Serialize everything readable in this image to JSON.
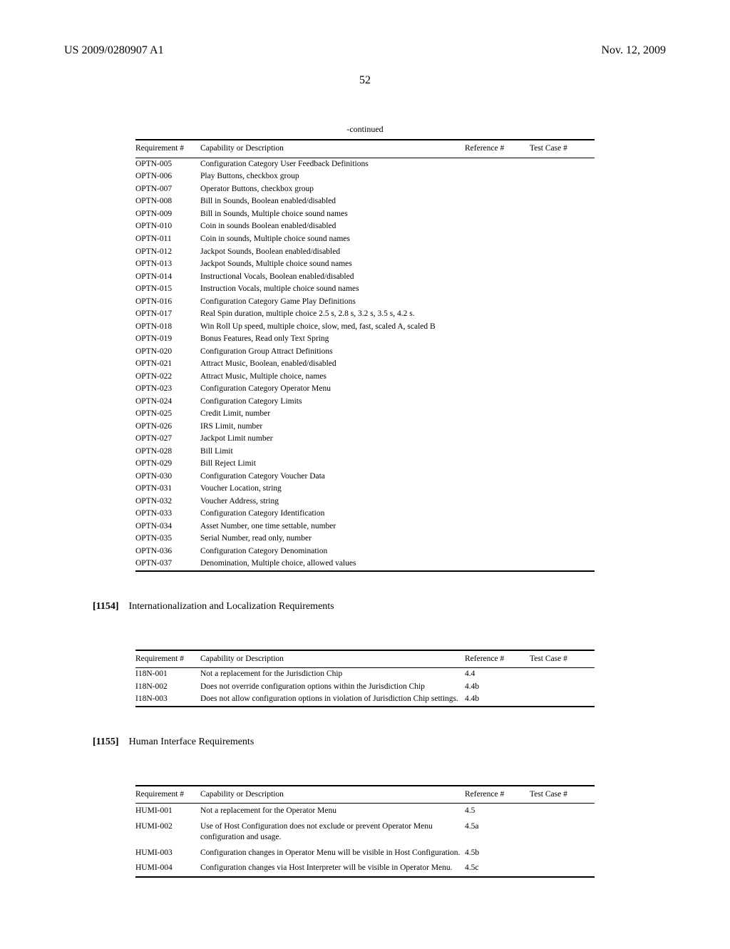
{
  "header": {
    "left": "US 2009/0280907 A1",
    "right": "Nov. 12, 2009"
  },
  "page_number": "52",
  "table1": {
    "caption": "-continued",
    "headers": {
      "req": "Requirement #",
      "desc": "Capability or Description",
      "ref": "Reference #",
      "tc": "Test Case #"
    },
    "rows": [
      {
        "req": "OPTN-005",
        "desc": "Configuration Category User Feedback Definitions",
        "ref": "",
        "tc": ""
      },
      {
        "req": "OPTN-006",
        "desc": "Play Buttons, checkbox group",
        "ref": "",
        "tc": ""
      },
      {
        "req": "OPTN-007",
        "desc": "Operator Buttons, checkbox group",
        "ref": "",
        "tc": ""
      },
      {
        "req": "OPTN-008",
        "desc": "Bill in Sounds, Boolean enabled/disabled",
        "ref": "",
        "tc": ""
      },
      {
        "req": "OPTN-009",
        "desc": "Bill in Sounds, Multiple choice sound names",
        "ref": "",
        "tc": ""
      },
      {
        "req": "OPTN-010",
        "desc": "Coin in sounds Boolean enabled/disabled",
        "ref": "",
        "tc": ""
      },
      {
        "req": "OPTN-011",
        "desc": "Coin in sounds, Multiple choice sound names",
        "ref": "",
        "tc": ""
      },
      {
        "req": "OPTN-012",
        "desc": "Jackpot Sounds, Boolean enabled/disabled",
        "ref": "",
        "tc": ""
      },
      {
        "req": "OPTN-013",
        "desc": "Jackpot Sounds, Multiple choice sound names",
        "ref": "",
        "tc": ""
      },
      {
        "req": "OPTN-014",
        "desc": "Instructional Vocals, Boolean enabled/disabled",
        "ref": "",
        "tc": ""
      },
      {
        "req": "OPTN-015",
        "desc": "Instruction Vocals, multiple choice sound names",
        "ref": "",
        "tc": ""
      },
      {
        "req": "OPTN-016",
        "desc": "Configuration Category Game Play Definitions",
        "ref": "",
        "tc": ""
      },
      {
        "req": "OPTN-017",
        "desc": "Real Spin duration, multiple choice 2.5 s, 2.8 s, 3.2 s, 3.5 s, 4.2 s.",
        "ref": "",
        "tc": ""
      },
      {
        "req": "OPTN-018",
        "desc": "Win Roll Up speed, multiple choice, slow, med, fast, scaled A, scaled B",
        "ref": "",
        "tc": ""
      },
      {
        "req": "OPTN-019",
        "desc": "Bonus Features, Read only Text Spring",
        "ref": "",
        "tc": ""
      },
      {
        "req": "OPTN-020",
        "desc": "Configuration Group Attract Definitions",
        "ref": "",
        "tc": ""
      },
      {
        "req": "OPTN-021",
        "desc": "Attract Music, Boolean, enabled/disabled",
        "ref": "",
        "tc": ""
      },
      {
        "req": "OPTN-022",
        "desc": "Attract Music, Multiple choice, names",
        "ref": "",
        "tc": ""
      },
      {
        "req": "OPTN-023",
        "desc": "Configuration Category Operator Menu",
        "ref": "",
        "tc": ""
      },
      {
        "req": "OPTN-024",
        "desc": "Configuration Category Limits",
        "ref": "",
        "tc": ""
      },
      {
        "req": "OPTN-025",
        "desc": "Credit Limit, number",
        "ref": "",
        "tc": ""
      },
      {
        "req": "OPTN-026",
        "desc": "IRS Limit, number",
        "ref": "",
        "tc": ""
      },
      {
        "req": "OPTN-027",
        "desc": "Jackpot Limit number",
        "ref": "",
        "tc": ""
      },
      {
        "req": "OPTN-028",
        "desc": "Bill Limit",
        "ref": "",
        "tc": ""
      },
      {
        "req": "OPTN-029",
        "desc": "Bill Reject Limit",
        "ref": "",
        "tc": ""
      },
      {
        "req": "OPTN-030",
        "desc": "Configuration Category Voucher Data",
        "ref": "",
        "tc": ""
      },
      {
        "req": "OPTN-031",
        "desc": "Voucher Location, string",
        "ref": "",
        "tc": ""
      },
      {
        "req": "OPTN-032",
        "desc": "Voucher Address, string",
        "ref": "",
        "tc": ""
      },
      {
        "req": "OPTN-033",
        "desc": "Configuration Category Identification",
        "ref": "",
        "tc": ""
      },
      {
        "req": "OPTN-034",
        "desc": "Asset Number, one time settable, number",
        "ref": "",
        "tc": ""
      },
      {
        "req": "OPTN-035",
        "desc": "Serial Number, read only, number",
        "ref": "",
        "tc": ""
      },
      {
        "req": "OPTN-036",
        "desc": "Configuration Category Denomination",
        "ref": "",
        "tc": ""
      },
      {
        "req": "OPTN-037",
        "desc": "Denomination, Multiple choice, allowed values",
        "ref": "",
        "tc": ""
      }
    ]
  },
  "section1": {
    "num": "[1154]",
    "title": "Internationalization and Localization Requirements"
  },
  "table2": {
    "headers": {
      "req": "Requirement #",
      "desc": "Capability or Description",
      "ref": "Reference #",
      "tc": "Test Case #"
    },
    "rows": [
      {
        "req": "I18N-001",
        "desc": "Not a replacement for the Jurisdiction Chip",
        "ref": "4.4",
        "tc": ""
      },
      {
        "req": "I18N-002",
        "desc": "Does not override configuration options within the Jurisdiction Chip",
        "ref": "4.4b",
        "tc": ""
      },
      {
        "req": "I18N-003",
        "desc": "Does not allow configuration options in violation of Jurisdiction Chip settings.",
        "ref": "4.4b",
        "tc": ""
      }
    ]
  },
  "section2": {
    "num": "[1155]",
    "title": "Human Interface Requirements"
  },
  "table3": {
    "headers": {
      "req": "Requirement #",
      "desc": "Capability or Description",
      "ref": "Reference #",
      "tc": "Test Case #"
    },
    "rows": [
      {
        "req": "HUMI-001",
        "desc": "Not a replacement for the Operator Menu",
        "ref": "4.5",
        "tc": ""
      },
      {
        "req": "HUMI-002",
        "desc": "Use of Host Configuration does not exclude or prevent Operator Menu configuration and usage.",
        "ref": "4.5a",
        "tc": ""
      },
      {
        "req": "HUMI-003",
        "desc": "Configuration changes in Operator Menu will be visible in Host Configuration.",
        "ref": "4.5b",
        "tc": ""
      },
      {
        "req": "HUMI-004",
        "desc": "Configuration changes via Host Interpreter will be visible in Operator Menu.",
        "ref": "4.5c",
        "tc": ""
      }
    ]
  }
}
